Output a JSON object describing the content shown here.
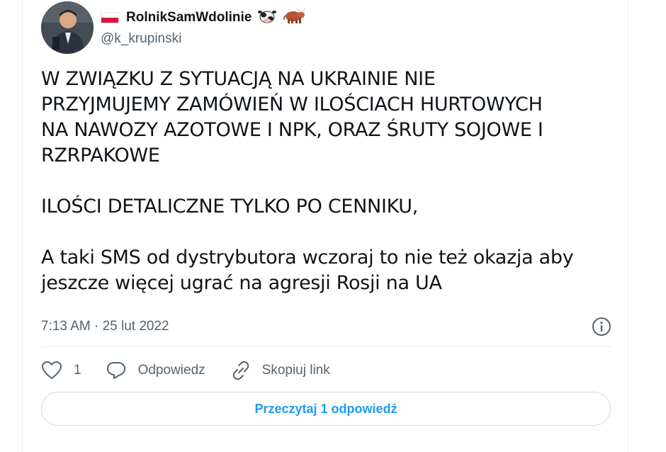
{
  "author": {
    "display_name": "RolnikSamWdolinie",
    "handle": "@k_krupinski",
    "flag_icon": "poland-flag-icon",
    "emoji": [
      "cow-face-emoji-icon",
      "ox-emoji-icon"
    ]
  },
  "tweet": {
    "text": "W ZWIĄZKU Z SYTUACJĄ NA UKRAINIE NIE\nPRZYJMUJEMY ZAMÓWIEŃ W ILOŚCIACH HURTOWYCH\nNA NAWOZY AZOTOWE I NPK, ORAZ ŚRUTY SOJOWE I\nRZRPAKOWE\n\nILOŚCI DETALICZNE TYLKO PO CENNIKU,\n\nA taki SMS od dystrybutora wczoraj to nie też okazja aby\njeszcze więcej ugrać na agresji Rosji na UA",
    "timestamp": "7:13 AM · 25 lut 2022"
  },
  "actions": {
    "like_count": "1",
    "reply_label": "Odpowiedz",
    "copy_link_label": "Skopiuj link"
  },
  "read_replies_label": "Przeczytaj 1 odpowiedź",
  "colors": {
    "link_blue": "#1d9bf0",
    "secondary_text": "#536471",
    "primary_text": "#0f1419",
    "border": "#cfd9de"
  }
}
